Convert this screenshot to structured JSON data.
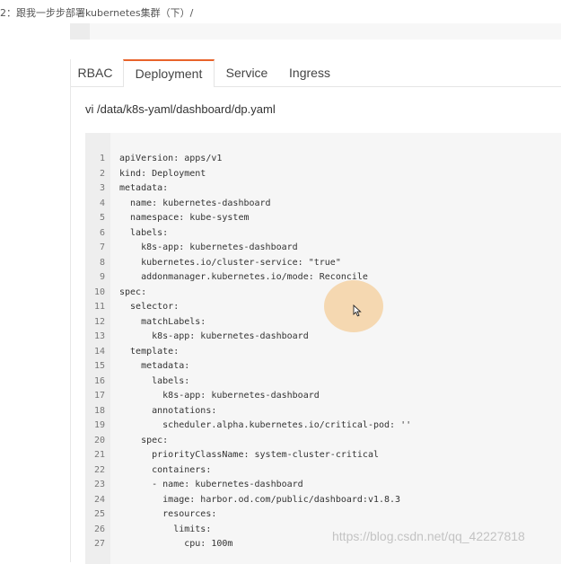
{
  "breadcrumb": {
    "text": "2：跟我一步步部署kubernetes集群（下）/"
  },
  "tabs": [
    {
      "label": "RBAC"
    },
    {
      "label": "Deployment",
      "active": true
    },
    {
      "label": "Service"
    },
    {
      "label": "Ingress"
    }
  ],
  "file_path": "vi /data/k8s-yaml/dashboard/dp.yaml",
  "code": {
    "lines": [
      {
        "n": "1",
        "t": "apiVersion: apps/v1"
      },
      {
        "n": "2",
        "t": "kind: Deployment"
      },
      {
        "n": "3",
        "t": "metadata:"
      },
      {
        "n": "4",
        "t": "  name: kubernetes-dashboard"
      },
      {
        "n": "5",
        "t": "  namespace: kube-system"
      },
      {
        "n": "6",
        "t": "  labels:"
      },
      {
        "n": "7",
        "t": "    k8s-app: kubernetes-dashboard"
      },
      {
        "n": "8",
        "t": "    kubernetes.io/cluster-service: \"true\""
      },
      {
        "n": "9",
        "t": "    addonmanager.kubernetes.io/mode: Reconcile"
      },
      {
        "n": "10",
        "t": "spec:"
      },
      {
        "n": "11",
        "t": "  selector:"
      },
      {
        "n": "12",
        "t": "    matchLabels:"
      },
      {
        "n": "13",
        "t": "      k8s-app: kubernetes-dashboard"
      },
      {
        "n": "14",
        "t": "  template:"
      },
      {
        "n": "15",
        "t": "    metadata:"
      },
      {
        "n": "16",
        "t": "      labels:"
      },
      {
        "n": "17",
        "t": "        k8s-app: kubernetes-dashboard"
      },
      {
        "n": "18",
        "t": "      annotations:"
      },
      {
        "n": "19",
        "t": "        scheduler.alpha.kubernetes.io/critical-pod: ''"
      },
      {
        "n": "20",
        "t": "    spec:"
      },
      {
        "n": "21",
        "t": "      priorityClassName: system-cluster-critical"
      },
      {
        "n": "22",
        "t": "      containers:"
      },
      {
        "n": "23",
        "t": "      - name: kubernetes-dashboard"
      },
      {
        "n": "24",
        "t": "        image: harbor.od.com/public/dashboard:v1.8.3"
      },
      {
        "n": "25",
        "t": "        resources:"
      },
      {
        "n": "26",
        "t": "          limits:"
      },
      {
        "n": "27",
        "t": "            cpu: 100m"
      }
    ]
  },
  "watermark": {
    "text": "https://blog.csdn.net/qq_42227818"
  },
  "colors": {
    "accent": "#e8632a",
    "code_bg": "#f6f6f6",
    "gutter_bg": "#eeeeee"
  },
  "icons": {
    "cursor": "mouse-pointer-icon"
  }
}
